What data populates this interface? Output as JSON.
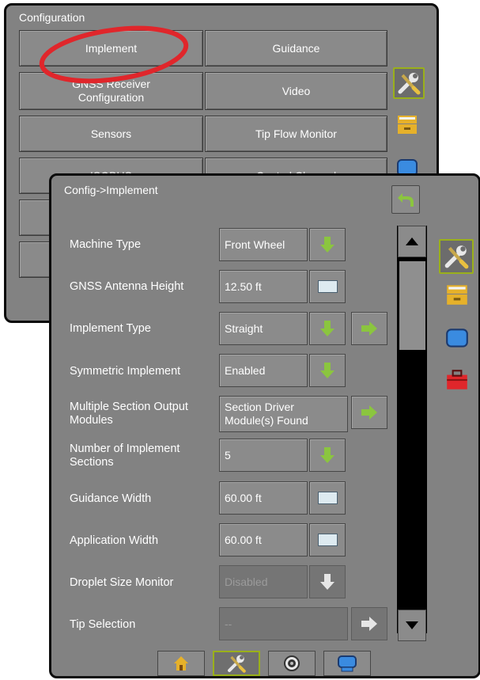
{
  "config_screen": {
    "header": "Configuration",
    "buttons": [
      {
        "id": "implement",
        "label": "Implement"
      },
      {
        "id": "guidance",
        "label": "Guidance"
      },
      {
        "id": "gnss",
        "label": "GNSS Receiver Configuration"
      },
      {
        "id": "video",
        "label": "Video"
      },
      {
        "id": "sensors",
        "label": "Sensors"
      },
      {
        "id": "tip_flow",
        "label": "Tip Flow Monitor"
      },
      {
        "id": "isobus",
        "label": "ISOBUS"
      },
      {
        "id": "control_channel",
        "label": "Control Channel"
      }
    ]
  },
  "implement_screen": {
    "breadcrumb": "Config->Implement",
    "rows": [
      {
        "label": "Machine Type",
        "value": "Front Wheel",
        "control": "dropdown"
      },
      {
        "label": "GNSS Antenna Height",
        "value": "12.50 ft",
        "control": "keyboard"
      },
      {
        "label": "Implement Type",
        "value": "Straight",
        "control": "dropdown",
        "next": true
      },
      {
        "label": "Symmetric Implement",
        "value": "Enabled",
        "control": "dropdown"
      },
      {
        "label": "Multiple Section Output Modules",
        "value": "Section Driver Module(s) Found",
        "control": "next"
      },
      {
        "label": "Number of Implement Sections",
        "value": "5",
        "control": "dropdown"
      },
      {
        "label": "Guidance Width",
        "value": "60.00 ft",
        "control": "keyboard"
      },
      {
        "label": "Application Width",
        "value": "60.00 ft",
        "control": "keyboard"
      },
      {
        "label": "Droplet Size Monitor",
        "value": "Disabled",
        "control": "dropdown",
        "disabled": true
      },
      {
        "label": "Tip Selection",
        "value": "--",
        "control": "next",
        "disabled": true
      }
    ]
  },
  "icons": {
    "back": "undo-arrow-icon",
    "tools": "tools-icon",
    "folder": "file-drawer-icon",
    "screen": "blue-screen-icon",
    "toolbox": "red-toolbox-icon",
    "home": "home-icon",
    "camera": "camera-icon"
  },
  "colors": {
    "panel": "#828282",
    "accent_green": "#8bc53f",
    "selected_border": "#9ab01a",
    "annotation_red": "#e0262b"
  },
  "scroll_position": 0
}
